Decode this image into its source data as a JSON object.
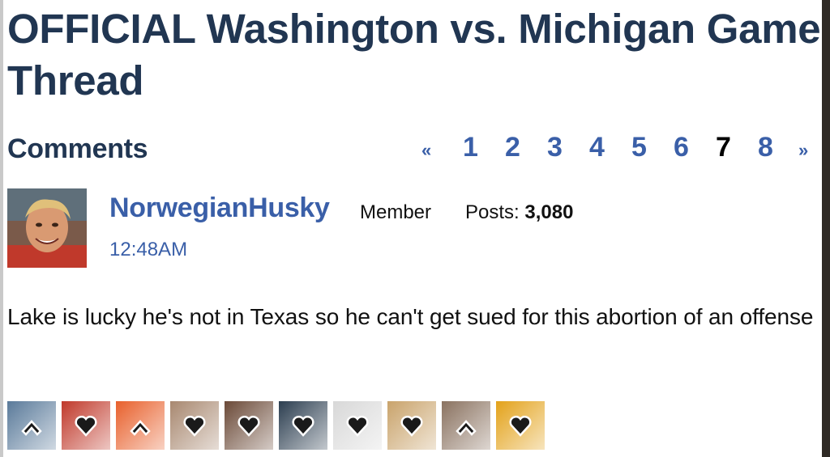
{
  "thread": {
    "title": "OFFICIAL Washington vs. Michigan Game Thread"
  },
  "comments": {
    "heading": "Comments"
  },
  "pagination": {
    "prev": "«",
    "pages": [
      "1",
      "2",
      "3",
      "4",
      "5",
      "6",
      "7",
      "8"
    ],
    "current_page": "7",
    "next": "»"
  },
  "post": {
    "username": "NorwegianHusky",
    "role": "Member",
    "posts_label": "Posts:",
    "posts_count": "3,080",
    "timestamp": "12:48AM",
    "body": "Lake is lucky he's not in Texas so he can't get sued for this abortion of an offense",
    "avatar_icon": "user-avatar-photo"
  },
  "reactions": [
    {
      "icon": "agree-arrow-icon",
      "color": "#5a7a9a"
    },
    {
      "icon": "like-heart-icon",
      "color": "#c0392b"
    },
    {
      "icon": "agree-arrow-icon",
      "color": "#e8602c"
    },
    {
      "icon": "like-heart-icon",
      "color": "#a88870"
    },
    {
      "icon": "like-heart-icon",
      "color": "#6b4a38"
    },
    {
      "icon": "like-heart-icon",
      "color": "#2c3e50"
    },
    {
      "icon": "like-heart-icon",
      "color": "#d8d8d8"
    },
    {
      "icon": "like-heart-icon",
      "color": "#c9a36b"
    },
    {
      "icon": "agree-arrow-icon",
      "color": "#8a7260"
    },
    {
      "icon": "like-heart-icon",
      "color": "#e3a21a"
    }
  ]
}
